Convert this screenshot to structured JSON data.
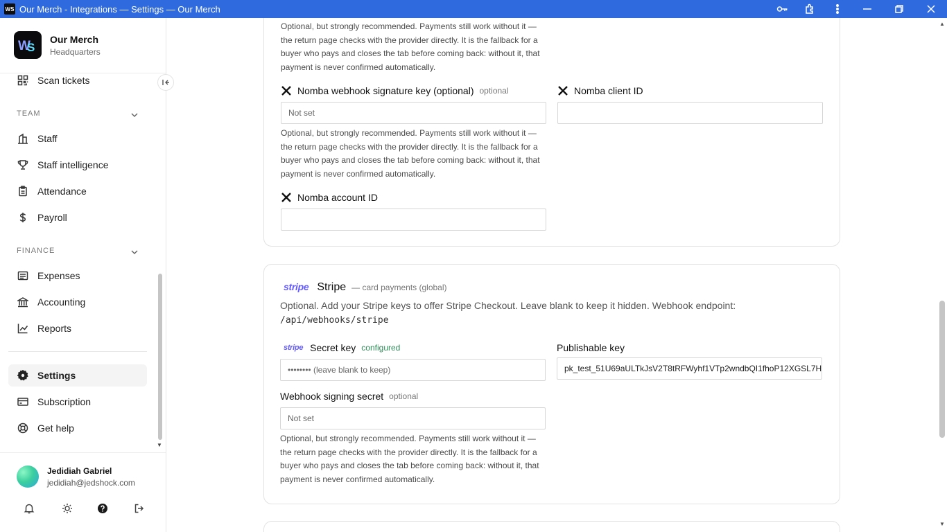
{
  "window": {
    "title": "Our Merch - Integrations — Settings — Our Merch",
    "app_icon_text": "WS"
  },
  "sidebar": {
    "brand_name": "Our Merch",
    "brand_sub": "Headquarters",
    "items_top": [
      {
        "label": "Scan tickets",
        "icon": "qr-scan-icon"
      }
    ],
    "team_label": "TEAM",
    "team_items": [
      {
        "label": "Staff",
        "icon": "building-icon"
      },
      {
        "label": "Staff intelligence",
        "icon": "trophy-icon"
      },
      {
        "label": "Attendance",
        "icon": "clipboard-icon"
      },
      {
        "label": "Payroll",
        "icon": "dollar-icon"
      }
    ],
    "finance_label": "FINANCE",
    "finance_items": [
      {
        "label": "Expenses",
        "icon": "receipt-icon"
      },
      {
        "label": "Accounting",
        "icon": "bank-icon"
      },
      {
        "label": "Reports",
        "icon": "chart-line-icon"
      }
    ],
    "bottom_items": [
      {
        "label": "Settings",
        "icon": "gear-icon",
        "active": true
      },
      {
        "label": "Subscription",
        "icon": "card-icon"
      },
      {
        "label": "Get help",
        "icon": "lifebuoy-icon"
      }
    ],
    "user": {
      "name": "Jedidiah Gabriel",
      "email": "jedidiah@jedshock.com"
    }
  },
  "nomba": {
    "help_text": "Optional, but strongly recommended. Payments still work without it — the return page checks with the provider directly. It is the fallback for a buyer who pays and closes the tab before coming back: without it, that payment is never confirmed automatically.",
    "webhook_key_label": "Nomba webhook signature key (optional)",
    "webhook_key_optional": "optional",
    "webhook_key_value": "Not set",
    "client_id_label": "Nomba client ID",
    "client_id_value": "",
    "account_id_label": "Nomba account ID",
    "account_id_value": ""
  },
  "stripe": {
    "logo_text": "stripe",
    "title": "Stripe",
    "subtitle": "— card payments (global)",
    "description": "Optional. Add your Stripe keys to offer Stripe Checkout. Leave blank to keep it hidden. Webhook endpoint:",
    "endpoint": "/api/webhooks/stripe",
    "secret_key_label": "Secret key",
    "secret_key_status": "configured",
    "secret_key_placeholder": "•••••••• (leave blank to keep)",
    "publishable_key_label": "Publishable key",
    "publishable_key_value": "pk_test_51U69aULTkJsV2T8tRFWyhf1VTp2wndbQI1fhoP12XGSL7H",
    "webhook_secret_label": "Webhook signing secret",
    "webhook_secret_optional": "optional",
    "webhook_secret_value": "Not set",
    "help_text": "Optional, but strongly recommended. Payments still work without it — the return page checks with the provider directly. It is the fallback for a buyer who pays and closes the tab before coming back: without it, that payment is never confirmed automatically."
  },
  "colors": {
    "titlebar": "#2f6bde",
    "stripe_brand": "#635bff",
    "configured": "#2e8b57"
  }
}
